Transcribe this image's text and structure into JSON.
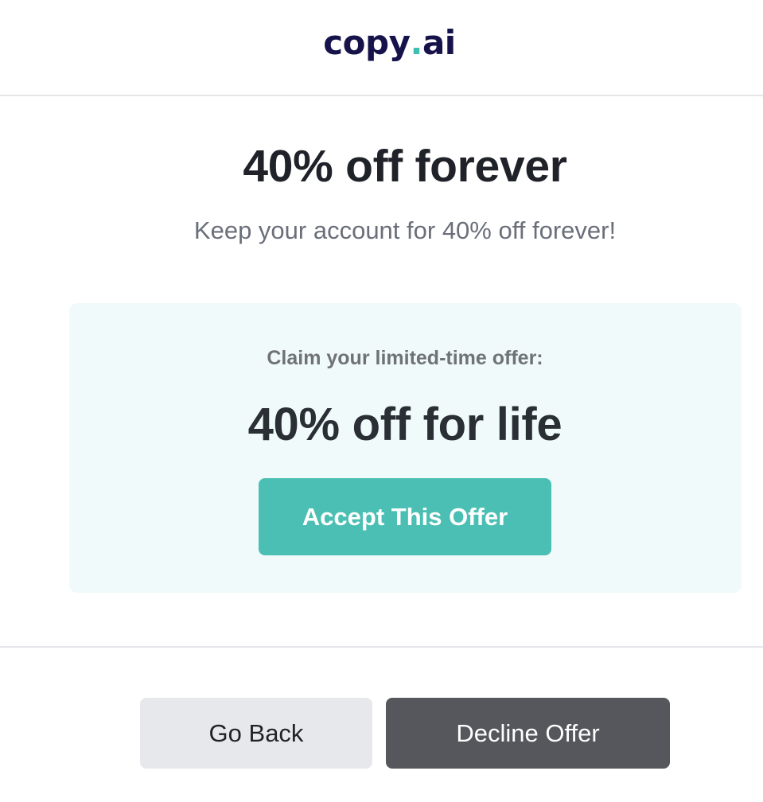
{
  "header": {
    "logo": {
      "part1": "copy",
      "dot": ".",
      "part2": "ai"
    }
  },
  "main": {
    "title": "40% off forever",
    "subtitle": "Keep your account for 40% off forever!"
  },
  "offer_card": {
    "claim_text": "Claim your limited-time offer:",
    "offer_text": "40% off for life",
    "accept_label": "Accept This Offer"
  },
  "footer": {
    "back_label": "Go Back",
    "decline_label": "Decline Offer"
  },
  "colors": {
    "brand_navy": "#16124a",
    "accent_teal": "#4bbfb3",
    "card_background": "#f1fafa",
    "decline_button": "#55575c",
    "back_button": "#e7e8eb"
  }
}
